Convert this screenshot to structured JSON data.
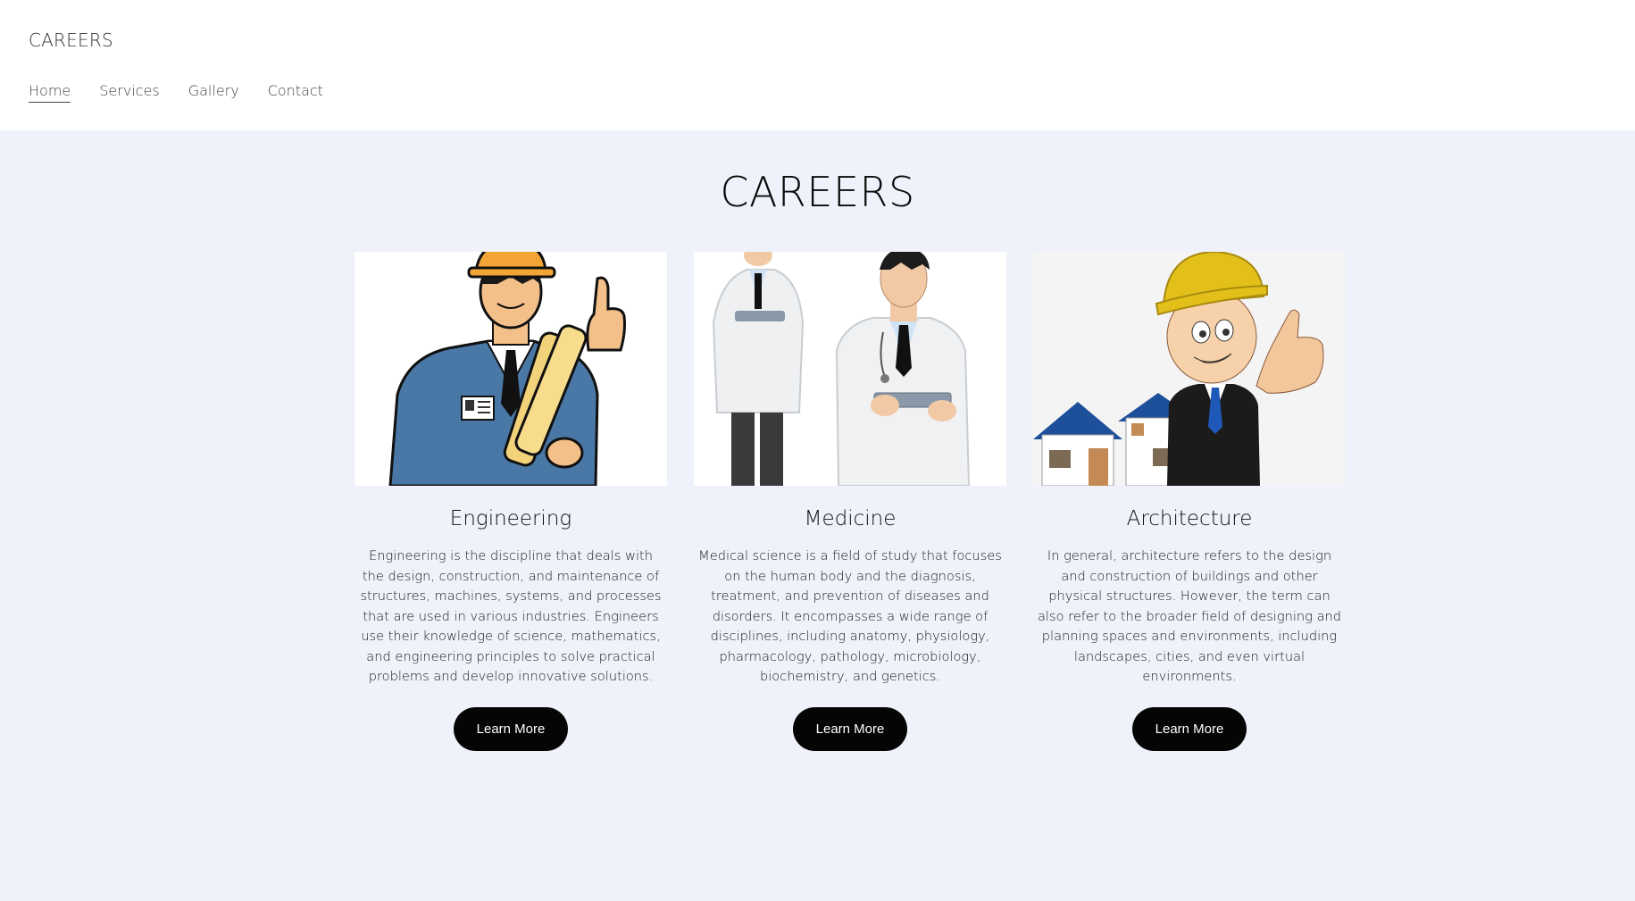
{
  "header": {
    "site_title": "CAREERS",
    "nav": [
      "Home",
      "Services",
      "Gallery",
      "Contact"
    ],
    "active_nav": "Home"
  },
  "main": {
    "heading": "CAREERS",
    "cards": [
      {
        "title": "Engineering",
        "text": "Engineering is the discipline that deals with the design, construction, and maintenance of structures, machines, systems, and processes that are used in various industries. Engineers use their knowledge of science, mathematics, and engineering principles to solve practical problems and develop innovative solutions.",
        "button": "Learn More",
        "image_icon": "engineer-illustration"
      },
      {
        "title": "Medicine",
        "text": "Medical science is a field of study that focuses on the human body and the diagnosis, treatment, and prevention of diseases and disorders. It encompasses a wide range of disciplines, including anatomy, physiology, pharmacology, pathology, microbiology, biochemistry, and genetics.",
        "button": "Learn More",
        "image_icon": "doctors-illustration"
      },
      {
        "title": "Architecture",
        "text": "In general, architecture refers to the design and construction of buildings and other physical structures. However, the term can also refer to the broader field of designing and planning spaces and environments, including landscapes, cities, and even virtual environments.",
        "button": "Learn More",
        "image_icon": "architect-illustration"
      }
    ]
  },
  "colors": {
    "page_bg": "#eff2fa",
    "header_bg": "#ffffff",
    "button_bg": "#050505",
    "button_text": "#ffffff"
  }
}
